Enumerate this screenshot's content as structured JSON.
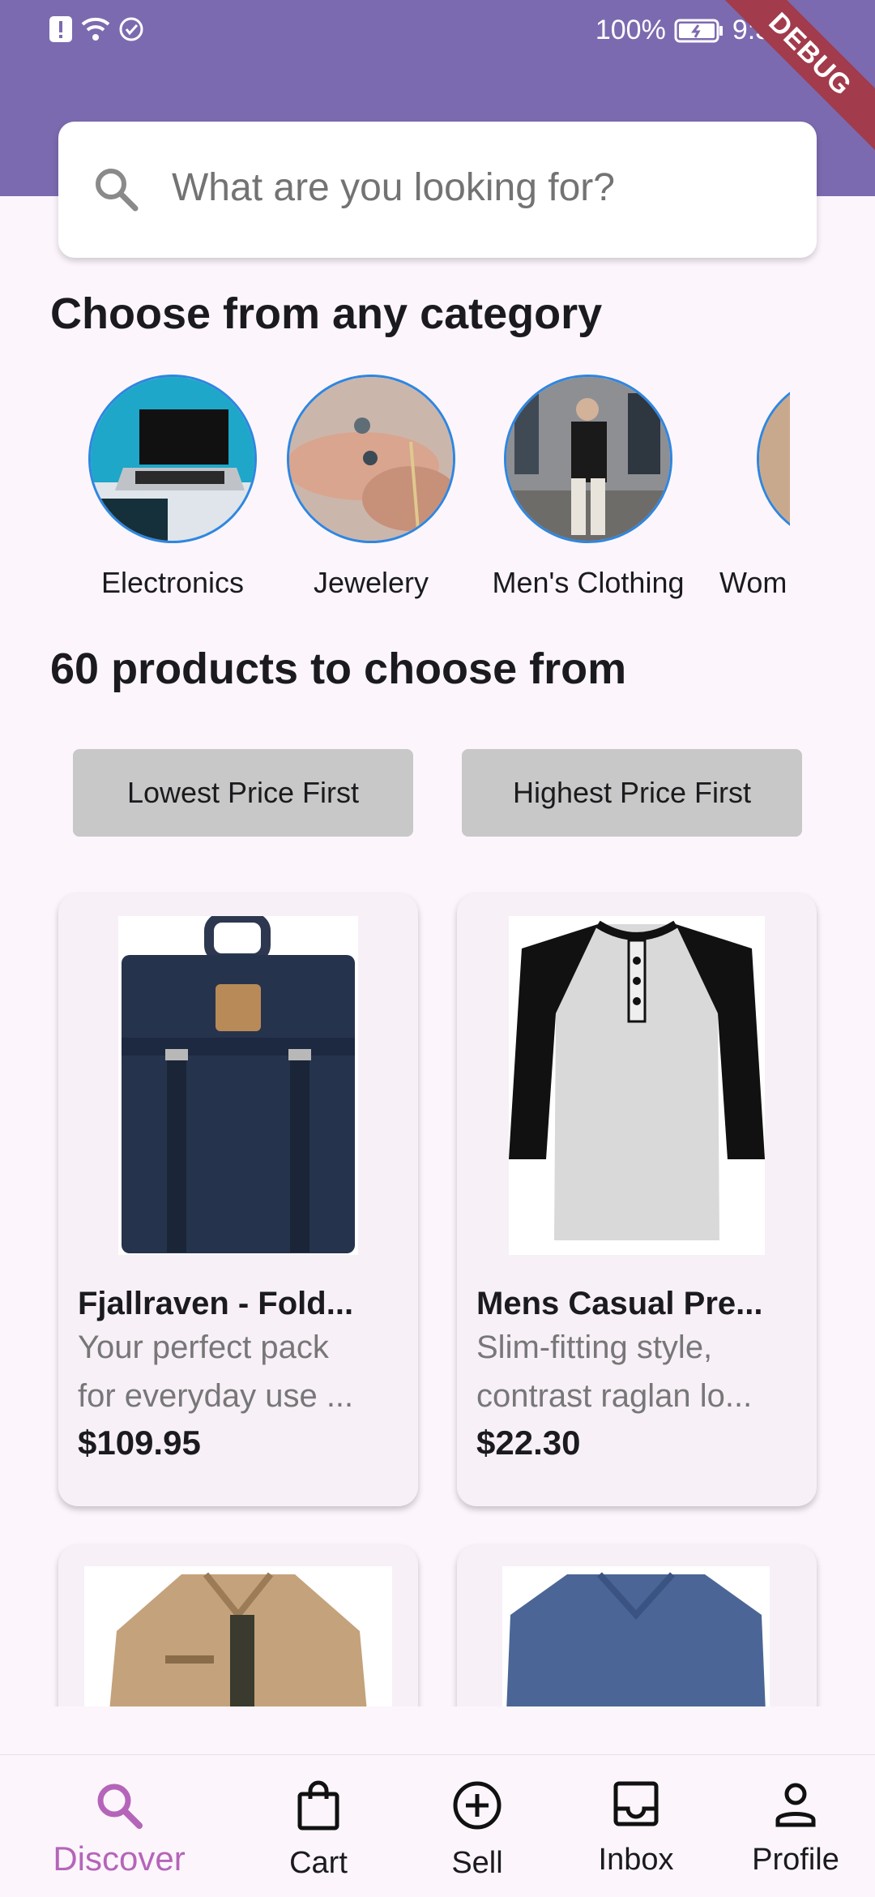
{
  "status_bar": {
    "battery": "100%",
    "time": "9:35",
    "debug_banner": "DEBUG"
  },
  "search": {
    "placeholder": "What are you looking for?"
  },
  "categories_section": {
    "title": "Choose from any category",
    "items": [
      {
        "label": "Electronics"
      },
      {
        "label": "Jewelery"
      },
      {
        "label": "Men's Clothing"
      },
      {
        "label": "Wom"
      }
    ]
  },
  "products_section": {
    "title": "60 products to choose from",
    "sort_lowest": "Lowest Price First",
    "sort_highest": "Highest Price First",
    "products": [
      {
        "title": "Fjallraven - Fold...",
        "desc_line1": "Your perfect pack",
        "desc_line2": "for everyday use ...",
        "price": "$109.95"
      },
      {
        "title": "Mens Casual Pre...",
        "desc_line1": "Slim-fitting style,",
        "desc_line2": "contrast raglan lo...",
        "price": "$22.30"
      },
      {
        "title": "",
        "desc_line1": "",
        "desc_line2": "",
        "price": ""
      },
      {
        "title": "",
        "desc_line1": "",
        "desc_line2": "",
        "price": ""
      }
    ]
  },
  "bottom_nav": {
    "items": [
      {
        "label": "Discover",
        "icon": "search-icon",
        "active": true
      },
      {
        "label": "Cart",
        "icon": "shopping-bag-icon",
        "active": false
      },
      {
        "label": "Sell",
        "icon": "add-circle-icon",
        "active": false
      },
      {
        "label": "Inbox",
        "icon": "inbox-icon",
        "active": false
      },
      {
        "label": "Profile",
        "icon": "person-icon",
        "active": false
      }
    ]
  },
  "colors": {
    "app_bar": "#7c6ab0",
    "background": "#fcf6fc",
    "accent_active": "#b565b9",
    "sort_button": "#c8c8c8"
  }
}
